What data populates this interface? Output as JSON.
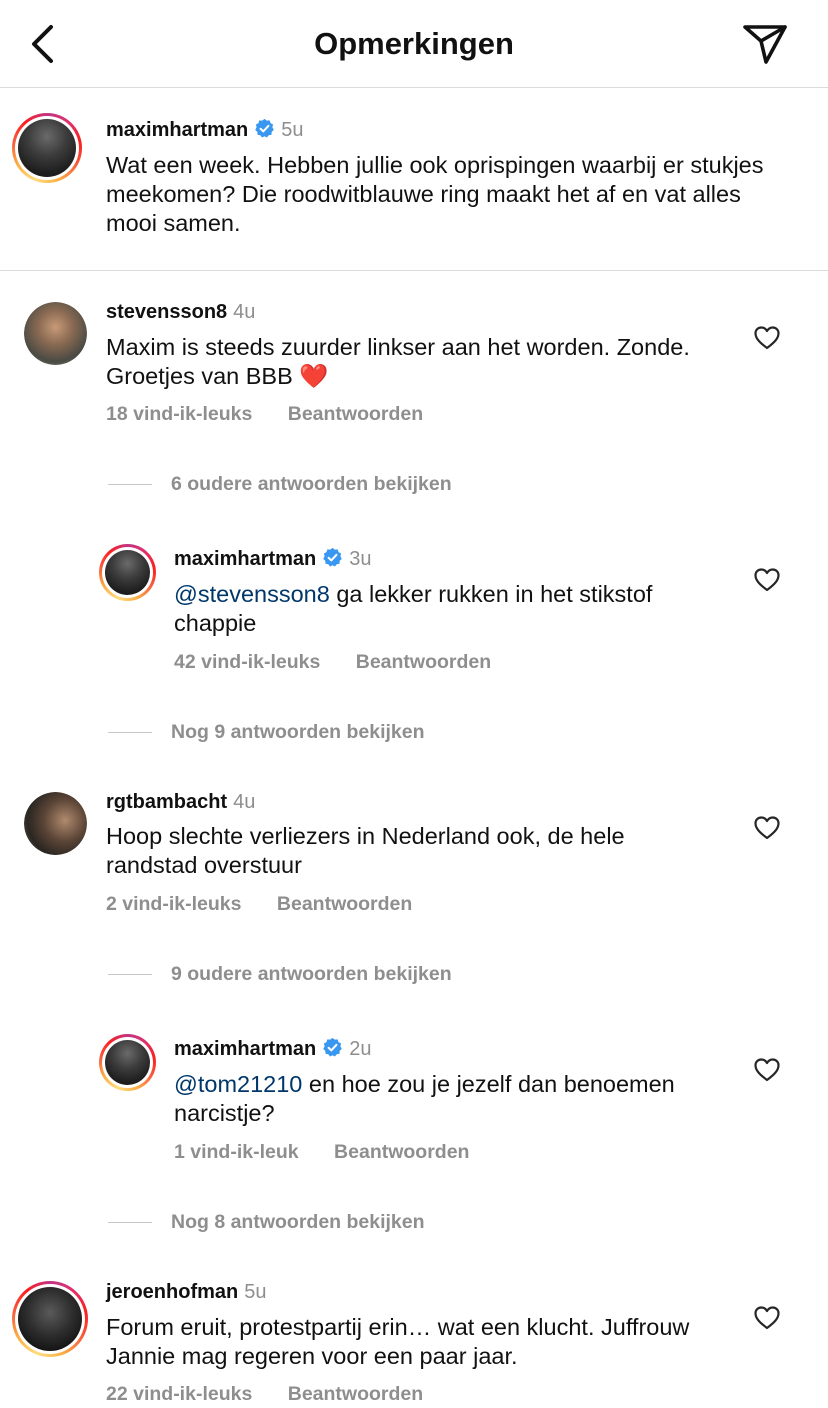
{
  "header": {
    "title": "Opmerkingen"
  },
  "caption": {
    "username": "maximhartman",
    "time": "5u",
    "text": "Wat een week. Hebben jullie ook oprispingen waarbij er stukjes meekomen? Die roodwitblauwe ring maakt het af en vat alles mooi samen."
  },
  "comments": [
    {
      "username": "stevensson8",
      "time": "4u",
      "text": "Maxim is steeds zuurder linkser aan het worden. Zonde. Groetjes van BBB ❤️",
      "likes": "18 vind-ik-leuks",
      "reply": "Beantwoorden"
    },
    {
      "username": "rgtbambacht",
      "time": "4u",
      "text": "Hoop slechte verliezers in Nederland ook, de hele randstad overstuur",
      "likes": "2 vind-ik-leuks",
      "reply": "Beantwoorden"
    },
    {
      "username": "jeroenhofman",
      "time": "5u",
      "text": "Forum eruit, protestpartij erin… wat een klucht. Juffrouw Jannie mag regeren voor een paar jaar.",
      "likes": "22 vind-ik-leuks",
      "reply": "Beantwoorden"
    }
  ],
  "replies": [
    {
      "username": "maximhartman",
      "time": "3u",
      "mention": "@stevensson8",
      "text": " ga lekker rukken in het stikstof chappie",
      "likes": "42 vind-ik-leuks",
      "reply": "Beantwoorden"
    },
    {
      "username": "maximhartman",
      "time": "2u",
      "mention": "@tom21210",
      "text": " en hoe zou je jezelf dan benoemen narcistje?",
      "likes": "1 vind-ik-leuk",
      "reply": "Beantwoorden"
    }
  ],
  "thread_links": {
    "older_1": "6 oudere antwoorden bekijken",
    "more_1": "Nog 9 antwoorden bekijken",
    "older_2": "9 oudere antwoorden bekijken",
    "more_2": "Nog 8 antwoorden bekijken"
  },
  "icons": {
    "back": "chevron-left-icon",
    "send": "paper-plane-icon",
    "like": "heart-outline-icon",
    "verified": "verified-badge-icon"
  },
  "colors": {
    "verified": "#3897f0",
    "mention": "#00376b",
    "secondary_text": "#8e8e8e",
    "divider": "#dbdbdb"
  }
}
